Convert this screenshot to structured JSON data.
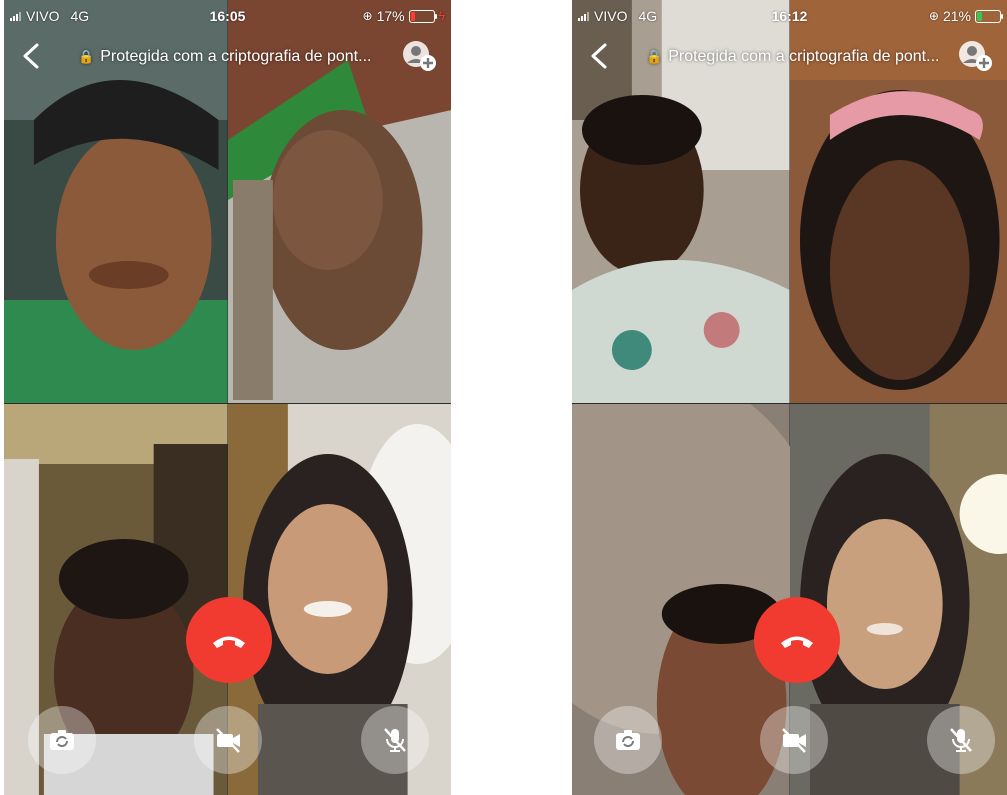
{
  "left_screen": {
    "status": {
      "carrier": "VIVO",
      "network": "4G",
      "time": "16:05",
      "battery": "17%",
      "battery_color": "#ff3b30"
    },
    "header": {
      "encryption_text": "Protegida com a criptografia de pont..."
    },
    "tiles": [
      "participant-man-cap",
      "participant-woman-braids",
      "participant-older-woman",
      "participant-young-woman"
    ]
  },
  "right_screen": {
    "status": {
      "carrier": "VIVO",
      "network": "4G",
      "time": "16:12",
      "battery": "21%",
      "battery_color": "#34c759"
    },
    "header": {
      "encryption_text": "Protegida com a criptografia de pont..."
    },
    "tiles": [
      "participant-woman-sofa",
      "participant-girl-headband",
      "participant-man-closeup",
      "participant-young-woman"
    ]
  },
  "controls": {
    "icons": [
      "camera-switch-icon",
      "video-off-icon",
      "mic-off-icon",
      "end-call-icon"
    ],
    "end_call_color": "#f23b30"
  }
}
